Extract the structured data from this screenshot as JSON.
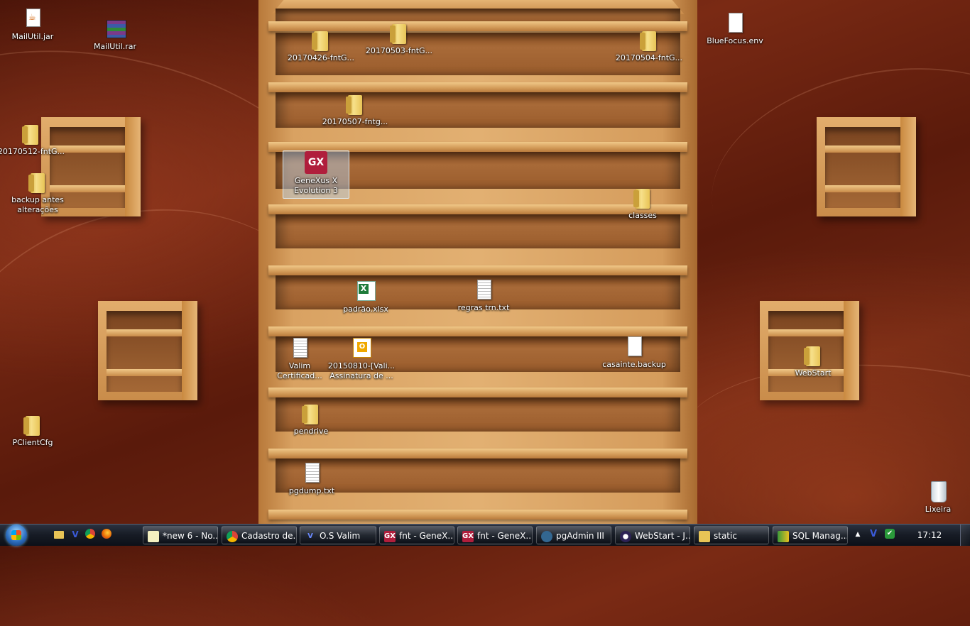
{
  "desktop": {
    "icons": {
      "mailutil_jar": "MailUtil.jar",
      "mailutil_rar": "MailUtil.rar",
      "folder_20170426": "20170426-fntG...",
      "folder_20170503": "20170503-fntG...",
      "folder_20170504": "20170504-fntG...",
      "bluefocus_env": "BlueFocus.env",
      "folder_20170507": "20170507-fntg...",
      "folder_20170512": "20170512-fntG...",
      "backup_line1": "backup antes",
      "backup_line2": "alterações",
      "genexus_line1": "GeneXus X",
      "genexus_line2": "Evolution 3",
      "classes": "classes",
      "padrao_xlsx": "padrão.xlsx",
      "regras_txt": "regras trn.txt",
      "valim_line1": "Valim",
      "valim_line2": "Certificad...",
      "msg_line1": "20150810-[Vali...",
      "msg_line2": "Assinatura de ...",
      "casainte_backup": "casainte.backup",
      "webstart": "WebStart",
      "pendrive": "pendrive",
      "pclientcfg": "PClientCfg",
      "pgdump_txt": "pgdump.txt",
      "lixeira": "Lixeira",
      "gx_logo": "GX"
    }
  },
  "taskbar": {
    "tasks": [
      {
        "label": "*new 6 - No...",
        "icon": "notepad-icon"
      },
      {
        "label": "Cadastro de...",
        "icon": "chrome-icon"
      },
      {
        "label": "O.S Valim",
        "icon": "v-icon"
      },
      {
        "label": "fnt - GeneX...",
        "icon": "genexus-icon"
      },
      {
        "label": "fnt - GeneX...",
        "icon": "genexus-icon"
      },
      {
        "label": "pgAdmin III",
        "icon": "pgadmin-icon"
      },
      {
        "label": "WebStart - J...",
        "icon": "eclipse-icon"
      },
      {
        "label": "static",
        "icon": "folder-icon"
      },
      {
        "label": "SQL Manag...",
        "icon": "sql-manager-icon"
      }
    ],
    "quick_launch": {
      "v": "V"
    },
    "tray": {
      "v": "V",
      "expand": "▲"
    },
    "clock": "17:12"
  }
}
